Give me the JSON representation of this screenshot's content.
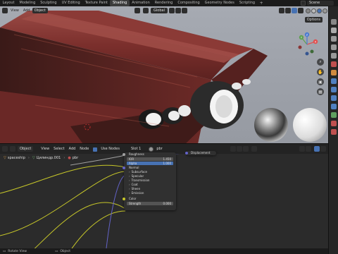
{
  "topbar": {
    "tabs": [
      {
        "label": "Layout"
      },
      {
        "label": "Modeling"
      },
      {
        "label": "Sculpting"
      },
      {
        "label": "UV Editing"
      },
      {
        "label": "Texture Paint"
      },
      {
        "label": "Shading",
        "active": true
      },
      {
        "label": "Animation"
      },
      {
        "label": "Rendering"
      },
      {
        "label": "Compositing"
      },
      {
        "label": "Geometry Nodes"
      },
      {
        "label": "Scripting"
      }
    ],
    "add_tab": "+",
    "scene": "Scene"
  },
  "viewport": {
    "menu": {
      "view": "View",
      "add": "Add",
      "object": "Object"
    },
    "orientation": "Global",
    "options_label": "Options",
    "gizmo": {
      "x": "X",
      "y": "Y",
      "z": "Z"
    },
    "colors": {
      "hull": "#7a2b2b",
      "accent": "#4772b3"
    }
  },
  "node_editor": {
    "header": {
      "editor_mode": "Object",
      "view": "View",
      "select": "Select",
      "add": "Add",
      "node": "Node",
      "use_nodes": "Use Nodes",
      "slot": "Slot 1",
      "material": "pbr"
    },
    "breadcrumb": [
      "spaceship",
      "Цилиндр.001",
      "pbr"
    ],
    "displacement_node": {
      "title": "Displacement"
    },
    "principled_node": {
      "roughness_label": "Roughness",
      "field_ior": {
        "label": "IOR",
        "value": "1.450"
      },
      "field_alpha": {
        "label": "Alpha",
        "value": "1.000"
      },
      "normal_label": "Normal",
      "panels": [
        "Subsurface",
        "Specular",
        "Transmission",
        "Coat",
        "Sheen",
        "Emission"
      ],
      "color_label": "Color",
      "strength": {
        "label": "Strength",
        "value": "0.000"
      }
    }
  },
  "statusbar": {
    "left": "Rotate View",
    "middle": "Object"
  }
}
